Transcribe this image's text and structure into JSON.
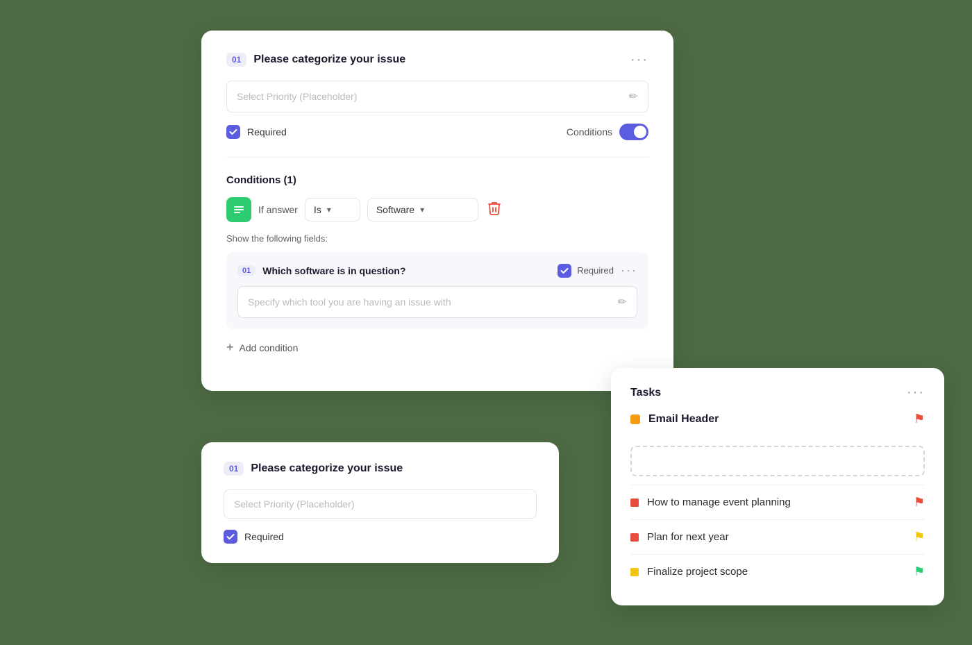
{
  "main_card": {
    "section1": {
      "step": "01",
      "title": "Please categorize your issue",
      "placeholder": "Select Priority (Placeholder)",
      "required_label": "Required",
      "conditions_label": "Conditions",
      "more_dots": "···"
    },
    "conditions_section": {
      "title": "Conditions (1)",
      "if_answer_label": "If answer",
      "dropdown_is": "Is",
      "dropdown_software": "Software",
      "show_fields_label": "Show the following fields:",
      "nested_field": {
        "step": "01",
        "title": "Which software is in question?",
        "required_label": "Required",
        "placeholder": "Specify which tool you are having an issue with"
      },
      "add_condition_label": "Add condition"
    }
  },
  "second_card": {
    "step": "01",
    "title": "Please categorize your issue",
    "placeholder": "Select Priority (Placeholder)",
    "required_label": "Required"
  },
  "tasks_panel": {
    "title": "Tasks",
    "more_dots": "···",
    "email_header": {
      "label": "Email Header",
      "flag_color": "red"
    },
    "items": [
      {
        "label": "How to manage event planning",
        "dot_color": "red",
        "flag_color": "red"
      },
      {
        "label": "Plan for next year",
        "dot_color": "red",
        "flag_color": "yellow"
      },
      {
        "label": "Finalize project scope",
        "dot_color": "yellow",
        "flag_color": "green"
      }
    ]
  }
}
